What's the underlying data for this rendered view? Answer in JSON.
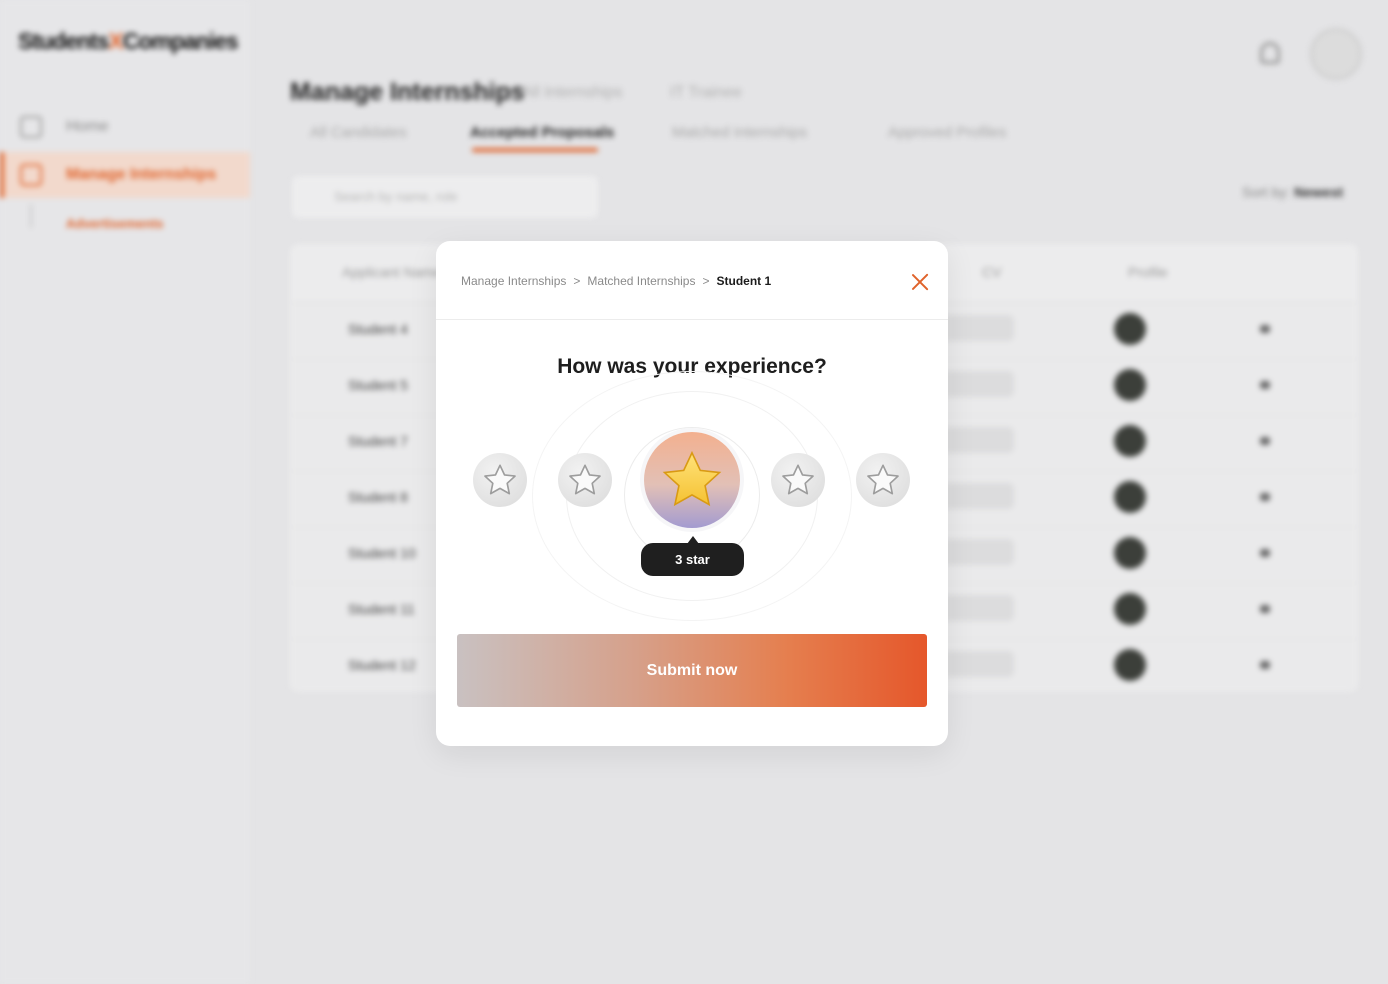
{
  "background": {
    "logo": {
      "part1": "Students",
      "part2": "X",
      "part3": "Companies"
    },
    "sidebar": {
      "items": [
        {
          "label": "Home",
          "icon": "home-icon"
        },
        {
          "label": "Manage Internships",
          "icon": "briefcase-icon"
        }
      ],
      "subitem": "Advertisements"
    },
    "header": {
      "title": "Manage Internships",
      "crumbs": [
        "All Internships",
        "IT Trainee"
      ]
    },
    "tabs": [
      "All Candidates",
      "Accepted Proposals",
      "Matched Internships",
      "Approved Profiles"
    ],
    "search_placeholder": "Search by name, role",
    "sort": {
      "label": "Sort by:",
      "value": "Newest"
    },
    "table": {
      "headers": [
        "Applicant Name",
        "CV",
        "Profile"
      ],
      "rows": [
        "Student 4",
        "Student 5",
        "Student 7",
        "Student 8",
        "Student 10",
        "Student 11",
        "Student 12"
      ]
    }
  },
  "modal": {
    "breadcrumb": [
      "Manage Internships",
      "Matched Internships",
      "Student 1"
    ],
    "separator": ">",
    "question": "How was your experience?",
    "rating": {
      "value": 3,
      "max": 5,
      "tooltip": "3 star"
    },
    "submit_label": "Submit now"
  },
  "colors": {
    "accent": "#e0632b",
    "star_gold": "#f5c232",
    "dark_tooltip": "#1f1f1f"
  }
}
